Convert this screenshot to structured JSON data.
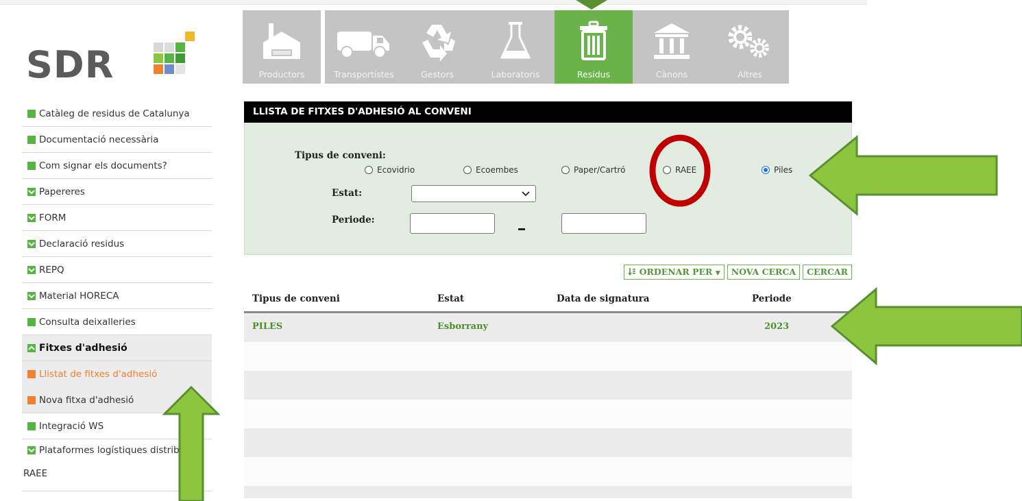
{
  "logo": {
    "text": "SDR"
  },
  "nav": {
    "tiles": [
      {
        "label": "Productors",
        "icon": "factory-icon",
        "active": false
      },
      {
        "label": "Transportistes",
        "icon": "truck-icon",
        "active": false
      },
      {
        "label": "Gestors",
        "icon": "recycle-icon",
        "active": false
      },
      {
        "label": "Laboratoris",
        "icon": "flask-icon",
        "active": false
      },
      {
        "label": "Residus",
        "icon": "trash-icon",
        "active": true
      },
      {
        "label": "Cànons",
        "icon": "bank-icon",
        "active": false
      },
      {
        "label": "Altres",
        "icon": "gears-icon",
        "active": false
      }
    ]
  },
  "sidebar": {
    "items": [
      {
        "label": "Catàleg de residus de Catalunya",
        "marker": "square"
      },
      {
        "label": "Documentació necessària",
        "marker": "square"
      },
      {
        "label": "Com signar els documents?",
        "marker": "square"
      },
      {
        "label": "Papereres",
        "marker": "check"
      },
      {
        "label": "FORM",
        "marker": "check"
      },
      {
        "label": "Declaració residus",
        "marker": "check"
      },
      {
        "label": "REPQ",
        "marker": "check"
      },
      {
        "label": "Material HORECA",
        "marker": "check"
      },
      {
        "label": "Consulta deixalleries",
        "marker": "square"
      },
      {
        "label": "Fitxes d'adhesió",
        "marker": "expand"
      },
      {
        "label": "Llistat de fitxes d'adhesió",
        "marker": "orange"
      },
      {
        "label": "Nova fitxa d'adhesió",
        "marker": "orange"
      },
      {
        "label": "Integració WS",
        "marker": "square"
      },
      {
        "label": "Plataformes logístiques distribu",
        "label2": "RAEE",
        "marker": "check"
      }
    ]
  },
  "panel": {
    "title": "LLISTA DE FITXES D'ADHESIÓ AL CONVENI",
    "filters": {
      "tipus_label": "Tipus de conveni:",
      "options": [
        {
          "label": "Ecovidrio",
          "selected": false
        },
        {
          "label": "Ecoembes",
          "selected": false
        },
        {
          "label": "Paper/Cartró",
          "selected": false
        },
        {
          "label": "RAEE",
          "selected": false
        },
        {
          "label": "Piles",
          "selected": true
        }
      ],
      "estat_label": "Estat:",
      "estat_value": "",
      "periode_label": "Periode:",
      "periode_from": "",
      "periode_to": ""
    },
    "buttons": {
      "order": "ORDENAR PER",
      "new_search": "NOVA CERCA",
      "search": "CERCAR"
    }
  },
  "table": {
    "columns": [
      "Tipus de conveni",
      "Estat",
      "Data de signatura",
      "Periode"
    ],
    "rows": [
      {
        "tipus": "PILES",
        "estat": "Esborrany",
        "data": "",
        "periode": "2023"
      }
    ]
  },
  "colors": {
    "accent": "#6ab34a",
    "tile": "#c4c4c4",
    "annotation_arrow": "#8cc63f",
    "annotation_circle": "#c00000",
    "orange": "#ef8131"
  }
}
